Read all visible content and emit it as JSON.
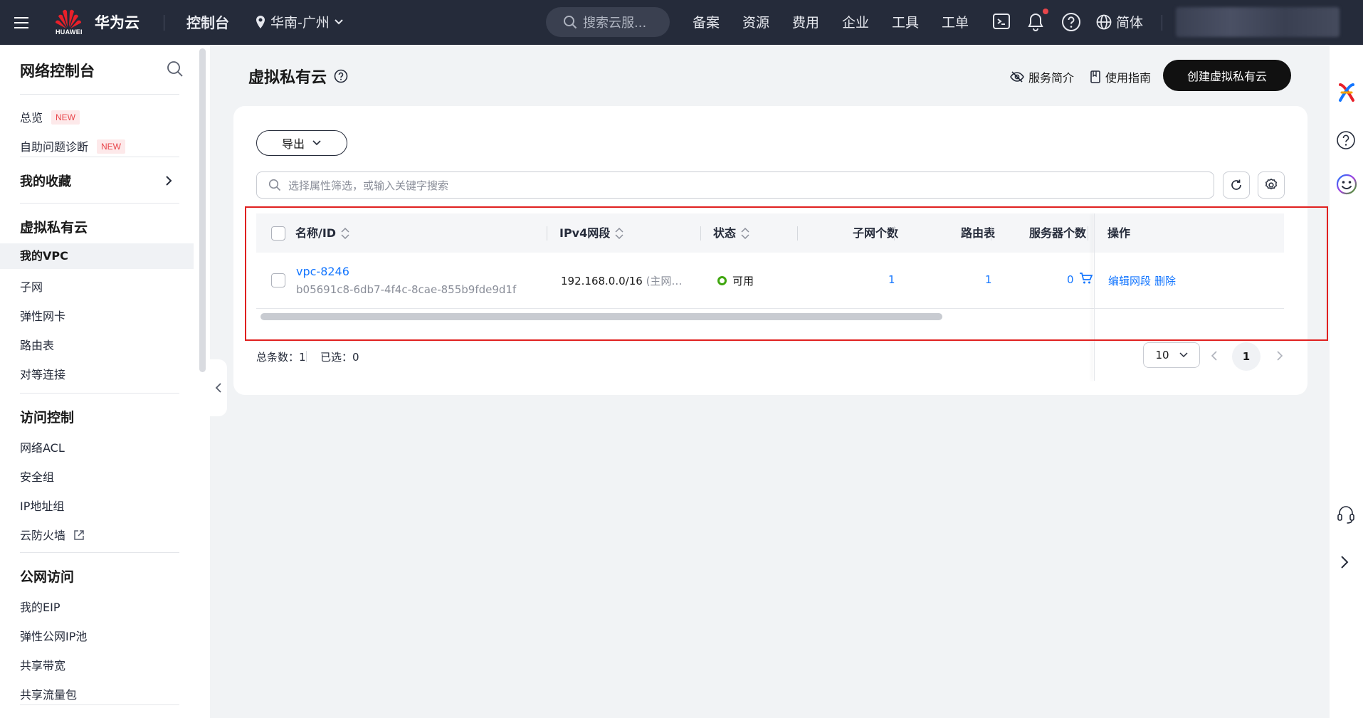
{
  "topbar": {
    "logo_text": "HUAWEI",
    "brand": "华为云",
    "console": "控制台",
    "region": "华南-广州",
    "search_placeholder": "搜索云服...",
    "nav": [
      "备案",
      "资源",
      "费用",
      "企业",
      "工具",
      "工单"
    ],
    "language": "简体"
  },
  "sidebar": {
    "title": "网络控制台",
    "new_badge": "NEW",
    "overview": "总览",
    "diagnosis": "自助问题诊断",
    "favorites": "我的收藏",
    "vpc_group": "虚拟私有云",
    "vpc_items": [
      "我的VPC",
      "子网",
      "弹性网卡",
      "路由表",
      "对等连接"
    ],
    "access_group": "访问控制",
    "access_items": [
      "网络ACL",
      "安全组",
      "IP地址组",
      "云防火墙"
    ],
    "public_group": "公网访问",
    "public_items": [
      "我的EIP",
      "弹性公网IP池",
      "共享带宽",
      "共享流量包"
    ]
  },
  "header": {
    "title": "虚拟私有云",
    "service_intro": "服务简介",
    "usage_guide": "使用指南",
    "create_button": "创建虚拟私有云"
  },
  "toolbar": {
    "export": "导出",
    "filter_placeholder": "选择属性筛选，或输入关键字搜索"
  },
  "table": {
    "columns": {
      "name": "名称/ID",
      "ipv4": "IPv4网段",
      "status": "状态",
      "subnets": "子网个数",
      "route_tables": "路由表",
      "servers": "服务器个数",
      "actions": "操作"
    },
    "rows": [
      {
        "name": "vpc-8246",
        "id": "b05691c8-6db7-4f4c-8cae-855b9fde9d1f",
        "ipv4": "192.168.0.0/16",
        "ipv4_note": "(主网…",
        "status": "可用",
        "subnets": "1",
        "route_tables": "1",
        "servers": "0",
        "action_edit": "编辑网段",
        "action_delete": "删除"
      }
    ]
  },
  "footer": {
    "total_label": "总条数：",
    "total": "1",
    "selected_label": "已选：",
    "selected": "0",
    "page_size": "10",
    "current_page": "1"
  },
  "colors": {
    "topbar_bg": "#252b3a",
    "accent_link": "#1476ff",
    "status_ok": "#3fa60f",
    "new_badge": "#e8464b",
    "highlight_box": "#e0201f",
    "primary_button": "#111111"
  }
}
